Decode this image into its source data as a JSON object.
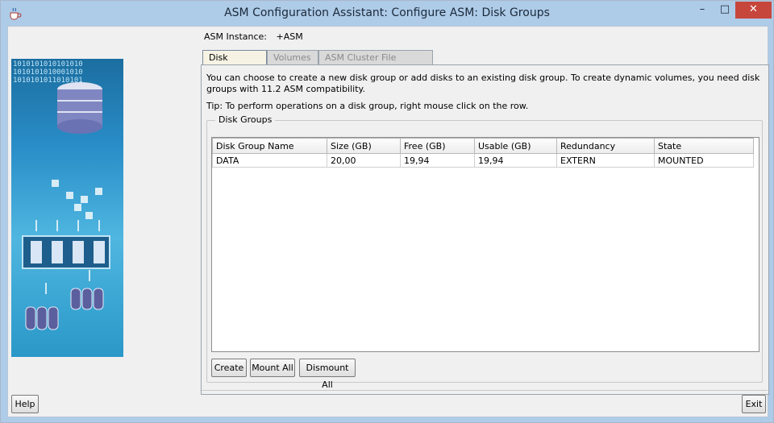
{
  "window": {
    "title": "ASM Configuration Assistant: Configure ASM: Disk Groups",
    "controls": [
      "–",
      "□",
      "✕"
    ]
  },
  "instance": {
    "label": "ASM Instance:",
    "value": "+ASM"
  },
  "tabs": [
    {
      "label": "Disk Groups",
      "active": true
    },
    {
      "label": "Volumes",
      "active": false
    },
    {
      "label": "ASM Cluster File Systems",
      "active": false
    }
  ],
  "intro": "You can choose to create a new disk group or add disks to an existing disk group. To create dynamic volumes, you need disk groups with 11.2 ASM compatibility.",
  "tip": "Tip: To perform operations on a disk group, right mouse click on the row.",
  "group_title": "Disk Groups",
  "table": {
    "columns": [
      "Disk Group Name",
      "Size (GB)",
      "Free (GB)",
      "Usable (GB)",
      "Redundancy",
      "State"
    ],
    "rows": [
      [
        "DATA",
        "20,00",
        "19,94",
        "19,94",
        "EXTERN",
        "MOUNTED"
      ]
    ]
  },
  "buttons": {
    "create": "Create",
    "mount_all": "Mount All",
    "dismount_all": "Dismount All",
    "help": "Help",
    "exit": "Exit"
  },
  "banner": {
    "binary": [
      "1010101010101010",
      "1010101010001010",
      "1010101011010101"
    ],
    "colors": {
      "top": "#1b6ea0",
      "mid": "#4fb6e0",
      "accent": "#bfe4f7"
    }
  },
  "icons": {
    "app": "java-cup-icon",
    "database": "database-cylinder-icon",
    "disk": "disk-icon"
  }
}
